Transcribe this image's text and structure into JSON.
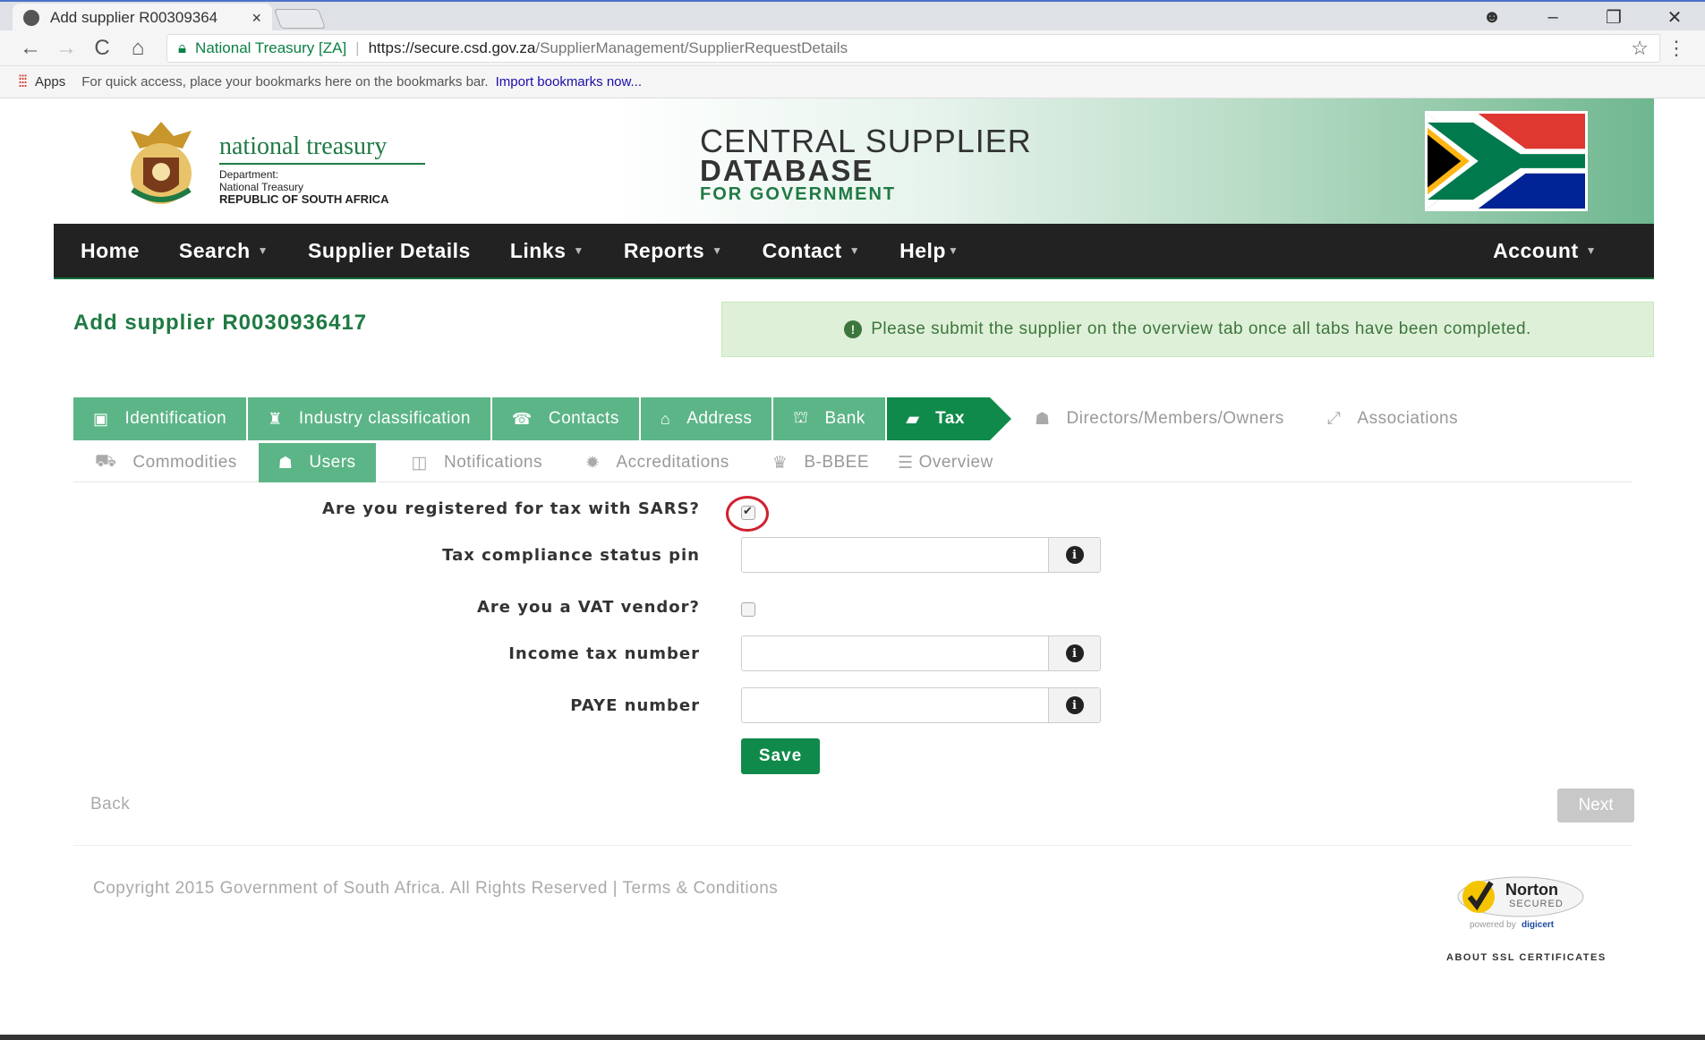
{
  "browser": {
    "tab_title": "Add supplier R00309364",
    "tab_close": "×",
    "controls": {
      "account": "☻",
      "minimize": "–",
      "restore": "❐",
      "close": "✕"
    },
    "nav": {
      "back": "←",
      "forward": "→",
      "reload": "C",
      "home": "⌂"
    },
    "site_identity": "National Treasury [ZA]",
    "url_host": "https://secure.csd.gov.za",
    "url_path": "/SupplierManagement/SupplierRequestDetails",
    "star": "☆",
    "menu": "⋮",
    "bookmarks": {
      "apps_label": "Apps",
      "hint": "For quick access, place your bookmarks here on the bookmarks bar.",
      "import_link": "Import bookmarks now..."
    }
  },
  "header": {
    "brand": "national treasury",
    "dept_line1": "Department:",
    "dept_line2": "National Treasury",
    "dept_line3": "REPUBLIC OF SOUTH AFRICA",
    "csd_line1": "CENTRAL SUPPLIER",
    "csd_line2": "DATABASE",
    "csd_line3": "FOR GOVERNMENT"
  },
  "navbar": {
    "items": [
      {
        "label": "Home",
        "caret": ""
      },
      {
        "label": "Search",
        "caret": "▼"
      },
      {
        "label": "Supplier Details",
        "caret": ""
      },
      {
        "label": "Links",
        "caret": "▼"
      },
      {
        "label": "Reports",
        "caret": "▼"
      },
      {
        "label": "Contact",
        "caret": "▼"
      },
      {
        "label": "Help",
        "caret": "▼"
      }
    ],
    "account": "Account",
    "account_caret": "▼"
  },
  "page_title": "Add supplier R0030936417",
  "alert": {
    "icon": "!",
    "text": "Please submit the supplier on the overview tab once all tabs have been completed."
  },
  "tabs_row1": [
    {
      "label": "Identification",
      "icon": "▣"
    },
    {
      "label": "Industry classification",
      "icon": "♜"
    },
    {
      "label": "Contacts",
      "icon": "☎"
    },
    {
      "label": "Address",
      "icon": "⌂"
    },
    {
      "label": "Bank",
      "icon": "⛫"
    },
    {
      "label": "Tax",
      "icon": "▰"
    },
    {
      "label": "Directors/Members/Owners",
      "icon": "☗"
    },
    {
      "label": "Associations",
      "icon": "⤢"
    }
  ],
  "tabs_row2": [
    {
      "label": "Commodities",
      "icon": "⛟"
    },
    {
      "label": "Users",
      "icon": "☗"
    },
    {
      "label": "Notifications",
      "icon": "◫"
    },
    {
      "label": "Accreditations",
      "icon": "✹"
    },
    {
      "label": "B-BBEE",
      "icon": "♛"
    },
    {
      "label": "Overview",
      "icon": "☰"
    }
  ],
  "form": {
    "sars_label": "Are you registered for tax with SARS?",
    "sars_checked": true,
    "tax_pin_label": "Tax compliance status pin",
    "tax_pin_value": "",
    "vat_label": "Are you a VAT vendor?",
    "vat_checked": false,
    "income_tax_label": "Income tax number",
    "income_tax_value": "",
    "paye_label": "PAYE number",
    "paye_value": "",
    "info_icon": "i",
    "save": "Save"
  },
  "footer": {
    "back": "Back",
    "next": "Next",
    "copyright": "Copyright 2015 Government of South Africa. All Rights Reserved | Terms & Conditions",
    "norton_brand": "Norton",
    "norton_secured": "SECURED",
    "norton_powered": "powered by",
    "norton_digicert": "digicert",
    "ssl_about": "ABOUT SSL CERTIFICATES"
  },
  "colors": {
    "brand_green": "#0f8a4a",
    "tab_green": "#5cb587",
    "navbar": "#222222",
    "alert_bg": "#dff0d8",
    "highlight_red": "#d02030"
  }
}
